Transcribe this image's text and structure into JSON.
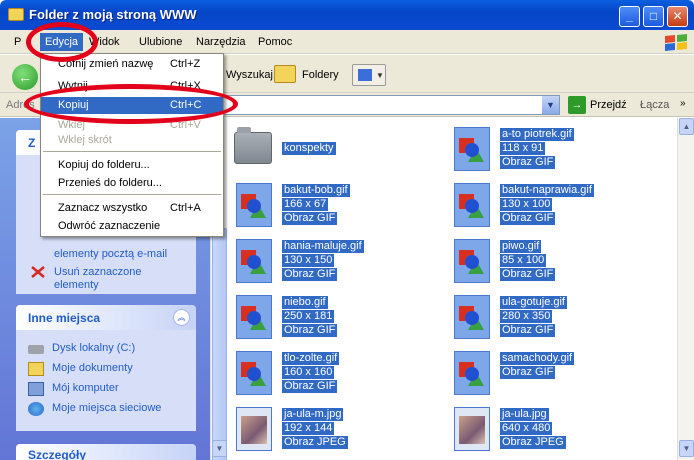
{
  "window": {
    "title": "Folder z moją stroną WWW"
  },
  "menu": [
    "P",
    "Edycja",
    "Widok",
    "Ulubione",
    "Narzędzia",
    "Pomoc"
  ],
  "toolbar": {
    "back": "Wstecz",
    "search": "Wyszukaj",
    "folders": "Foldery"
  },
  "address": {
    "label": "Adres",
    "go": "Przejdź",
    "links": "Łącza"
  },
  "edit_menu": [
    {
      "label": "Cofnij zmień nazwę",
      "key": "Ctrl+Z",
      "state": "normal"
    },
    {
      "label": "Wytnij",
      "key": "Ctrl+X",
      "state": "normal"
    },
    {
      "label": "Kopiuj",
      "key": "Ctrl+C",
      "state": "selected"
    },
    {
      "label": "Wklej",
      "key": "Ctrl+V",
      "state": "disabled"
    },
    {
      "label": "Wklej skrót",
      "key": "",
      "state": "disabled"
    },
    {
      "label": "Kopiuj do folderu...",
      "key": "",
      "state": "normal"
    },
    {
      "label": "Przenieś do folderu...",
      "key": "",
      "state": "normal"
    },
    {
      "label": "Zaznacz wszystko",
      "key": "Ctrl+A",
      "state": "normal"
    },
    {
      "label": "Odwróć zaznaczenie",
      "key": "",
      "state": "normal"
    }
  ],
  "tasks_panel": {
    "title": "Z",
    "items": [
      "elementy pocztą e-mail",
      "Usuń zaznaczone",
      "elementy"
    ]
  },
  "other_places": {
    "title": "Inne miejsca",
    "items": [
      "Dysk lokalny (C:)",
      "Moje dokumenty",
      "Mój komputer",
      "Moje miejsca sieciowe"
    ]
  },
  "details_panel": {
    "title": "Szczegóły"
  },
  "files": [
    {
      "name": "konspekty",
      "dims": "",
      "type": "",
      "kind": "folder"
    },
    {
      "name": "a-to piotrek.gif",
      "dims": "118 x 91",
      "type": "Obraz GIF",
      "kind": "gif"
    },
    {
      "name": "bakut-bob.gif",
      "dims": "166 x 67",
      "type": "Obraz GIF",
      "kind": "gif"
    },
    {
      "name": "bakut-naprawia.gif",
      "dims": "130 x 100",
      "type": "Obraz GIF",
      "kind": "gif"
    },
    {
      "name": "hania-maluje.gif",
      "dims": "130 x 150",
      "type": "Obraz GIF",
      "kind": "gif"
    },
    {
      "name": "piwo.gif",
      "dims": "85 x 100",
      "type": "Obraz GIF",
      "kind": "gif"
    },
    {
      "name": "niebo.gif",
      "dims": "250 x 181",
      "type": "Obraz GIF",
      "kind": "gif"
    },
    {
      "name": "ula-gotuje.gif",
      "dims": "280 x 350",
      "type": "Obraz GIF",
      "kind": "gif"
    },
    {
      "name": "tlo-zolte.gif",
      "dims": "160 x 160",
      "type": "Obraz GIF",
      "kind": "gif"
    },
    {
      "name": "samachody.gif",
      "dims": "",
      "type": "Obraz GIF",
      "kind": "gif"
    },
    {
      "name": "ja-ula-m.jpg",
      "dims": "192 x 144",
      "type": "Obraz JPEG",
      "kind": "jpg"
    },
    {
      "name": "ja-ula.jpg",
      "dims": "640 x 480",
      "type": "Obraz JPEG",
      "kind": "jpg"
    }
  ]
}
